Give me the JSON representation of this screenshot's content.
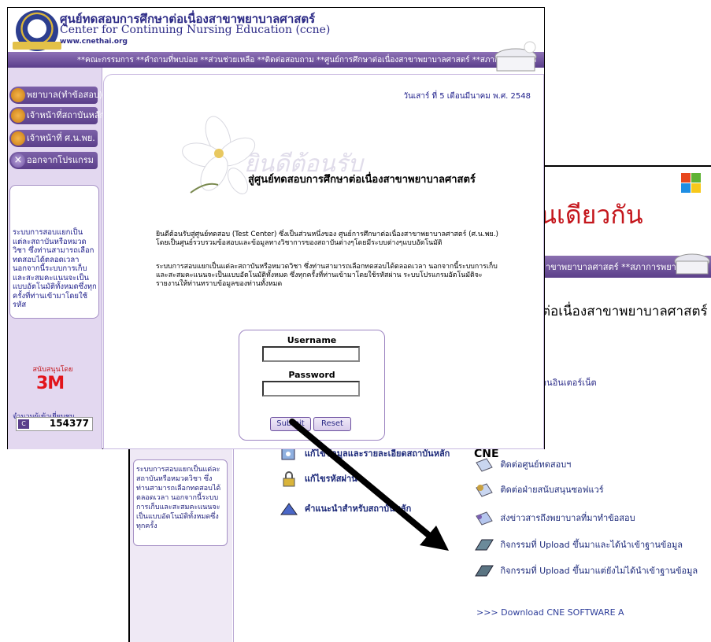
{
  "back_window": {
    "big_title": "นเดียวกัน",
    "nav_text": "าขาพยาบาลศาสตร์  **สภาการพยาบาล",
    "heading": "ต่อเนื่องสาขาพยาบาลศาสตร์",
    "internet_link": "านอินเตอร์เน็ต",
    "sidebox_text": "ระบบการสอบแยกเป็นแต่ละสถาบันหรือหมวดวิชา ซึ่งท่านสามารถเลือกทดสอบได้ตลอดเวลา นอกจากนี้ระบบการเก็บและสะสมคะแนนจะเป็นแบบอัตโนมัติทั้งหมดซึ่งทุกครั้ง",
    "left_menu": [
      "แก้ไขข้อมูลและรายละเอียดสถาบันหลัก",
      "แก้ไขรหัสผ่าน",
      "คำแนะนำสำหรับสถาบันหลัก"
    ],
    "cne_title": "CNE",
    "cne_items": [
      "ติดต่อศูนย์ทดสอบฯ",
      "ติดต่อฝ่ายสนับสนุนซอฟแวร์",
      "ส่งข่าวสารถึงพยาบาลที่มาทำข้อสอบ",
      "กิจกรรมที่ Upload ขึ้นมาและได้นำเข้าฐานข้อมูล",
      "กิจกรรมที่ Upload ขึ้นมาแต่ยังไม่ได้นำเข้าฐานข้อมูล"
    ],
    "download": ">>> Download CNE SOFTWARE A"
  },
  "front_window": {
    "site_title_th": "ศูนย์ทดสอบการศึกษาต่อเนื่องสาขาพยาบาลศาสตร์",
    "site_title_en": "Center for Continuing Nursing Education (ccne)",
    "site_url": "www.cnethai.org",
    "nav_text": "**คณะกรรมการ  **คำถามที่พบบ่อย  **ส่วนช่วยเหลือ  **ติดต่อสอบถาม  **ศูนย์การศึกษาต่อเนื่องสาขาพยาบาลศาสตร์  **สภาการพยาบาล",
    "left_buttons": [
      "พยาบาล(ทำข้อสอบ)",
      "เจ้าหน้าที่สถาบันหลัก",
      "เจ้าหน้าที่ ศ.น.พย.",
      "ออกจากโปรแกรม"
    ],
    "info_text": "ระบบการสอบแยกเป็นแต่ละสถาบันหรือหมวดวิชา ซึ่งท่านสามารถเลือกทดสอบได้ตลอดเวลา นอกจากนี้ระบบการเก็บและสะสมคะแนนจะเป็นแบบอัตโนมัติทั้งหมดซึ่งทุกครั้งที่ท่านเข้ามาโดยใช้รหัส",
    "sponsor_label": "สนับสนุนโดย",
    "sponsor_logo": "3M",
    "visitors_label": "จำนวนผู้เข้าเยี่ยมชม",
    "counter_icon": "C",
    "counter_value": "154377",
    "date": "วันเสาร์ ที่ 5 เดือนมีนาคม พ.ศ. 2548",
    "welcome_watermark": "ยินดีต้อนรับ",
    "welcome_title": "สู่ศูนย์ทดสอบการศึกษาต่อเนื่องสาขาพยาบาลศาสตร์",
    "para1": "ยินดีต้อนรับสู่ศูนย์ทดสอบ (Test Center) ซึ่งเป็นส่วนหนึ่งของ ศูนย์การศึกษาต่อเนื่องสาขาพยาบาลศาสตร์ (ศ.น.พย.) โดยเป็นศูนย์รวบรวมข้อสอบและข้อมูลทางวิชาการของสถาบันต่างๆโดยมีระบบต่างๆแบบอัตโนมัติ",
    "para2": "ระบบการสอบแยกเป็นแต่ละสถาบันหรือหมวดวิชา ซึ่งท่านสามารถเลือกทดสอบได้ตลอดเวลา นอกจากนี้ระบบการเก็บและสะสมคะแนนจะเป็นแบบอัตโนมัติทั้งหมด ซึ่งทุกครั้งที่ท่านเข้ามาโดยใช้รหัสผ่าน ระบบโปรแกรมอัตโนมัติจะรายงานให้ท่านทราบข้อมูลของท่านทั้งหมด",
    "login": {
      "username_label": "Username",
      "password_label": "Password",
      "username_value": "",
      "password_value": "",
      "submit_label": "Submit",
      "reset_label": "Reset"
    }
  },
  "colors": {
    "accent_purple": "#5b3f8a",
    "title_blue": "#2c2a86",
    "brand_red": "#e2141b"
  }
}
